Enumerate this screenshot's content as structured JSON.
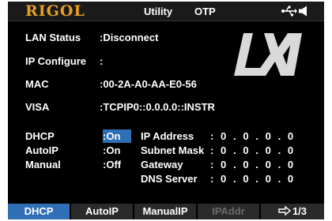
{
  "header": {
    "brand": "RIGOL",
    "menu": "Utility",
    "mode": "OTP"
  },
  "status": [
    {
      "label": "LAN Status",
      "value": ":Disconnect"
    },
    {
      "label": "IP Configure",
      "value": ":"
    },
    {
      "label": "MAC",
      "value": ":00-2A-A0-AA-E0-56"
    },
    {
      "label": "VISA",
      "value": ":TCPIP0::0.0.0.0::INSTR"
    }
  ],
  "modes": [
    {
      "label": "DHCP",
      "value": ":On"
    },
    {
      "label": "AutoIP",
      "value": ":On"
    },
    {
      "label": "Manual",
      "value": ":Off"
    }
  ],
  "network": [
    {
      "label": "IP Address",
      "value": ":  0  .  0  .  0  .  0"
    },
    {
      "label": "Subnet Mask",
      "value": ":  0  .  0  .  0  .  0"
    },
    {
      "label": "Gateway",
      "value": ":  0  .  0  .  0  .  0"
    },
    {
      "label": "DNS Server",
      "value": ":  0  .  0  .  0  .  0"
    }
  ],
  "softkeys": [
    {
      "label": "DHCP",
      "state": "active"
    },
    {
      "label": "AutoIP",
      "state": "normal"
    },
    {
      "label": "ManualIP",
      "state": "normal"
    },
    {
      "label": "IPAddr",
      "state": "disabled"
    },
    {
      "label": "1/3",
      "state": "normal"
    }
  ],
  "colors": {
    "brand": "#e8a11c",
    "accent": "#2f6fb5",
    "background": "#000000",
    "disabled": "#6a6a6a"
  },
  "icons": [
    "usb-icon",
    "speaker-icon",
    "lxi-logo",
    "next-page-arrow-icon"
  ]
}
